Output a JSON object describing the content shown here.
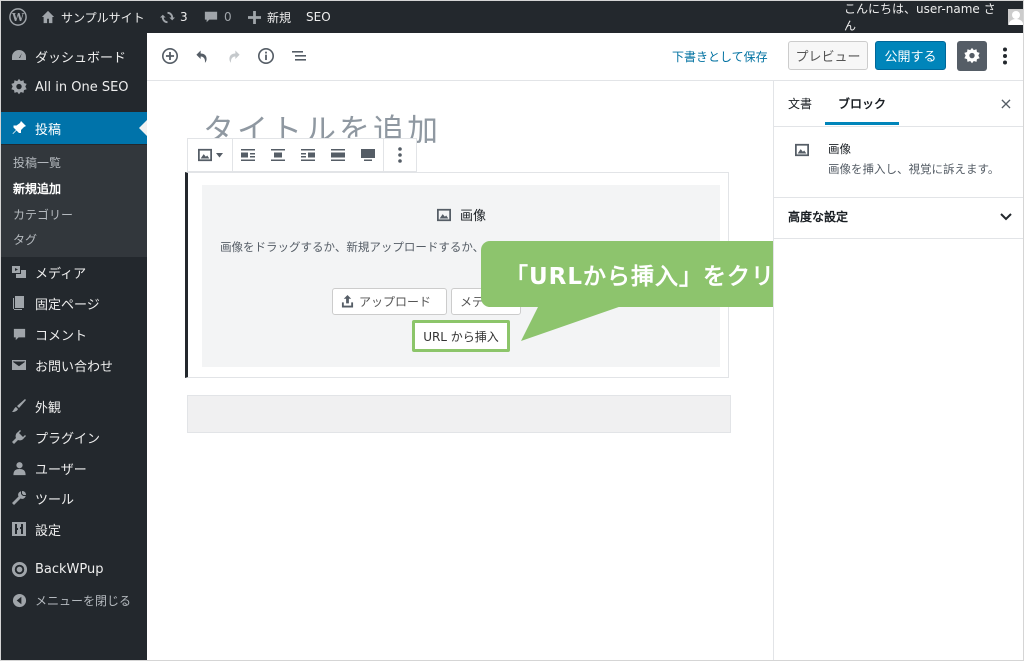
{
  "adminbar": {
    "site_name": "サンプルサイト",
    "updates_count": "3",
    "comments_count": "0",
    "new_label": "新規",
    "seo_label": "SEO",
    "greeting": "こんにちは、user-name さん"
  },
  "sidebar": {
    "items": [
      {
        "label": "ダッシュボード",
        "icon": "dashboard-icon"
      },
      {
        "label": "All in One SEO",
        "icon": "gear-icon"
      },
      {
        "label": "投稿",
        "icon": "pin-icon"
      },
      {
        "label": "メディア",
        "icon": "media-icon"
      },
      {
        "label": "固定ページ",
        "icon": "page-icon"
      },
      {
        "label": "コメント",
        "icon": "comment-icon"
      },
      {
        "label": "お問い合わせ",
        "icon": "mail-icon"
      },
      {
        "label": "外観",
        "icon": "brush-icon"
      },
      {
        "label": "プラグイン",
        "icon": "plugin-icon"
      },
      {
        "label": "ユーザー",
        "icon": "user-icon"
      },
      {
        "label": "ツール",
        "icon": "wrench-icon"
      },
      {
        "label": "設定",
        "icon": "settings-icon"
      },
      {
        "label": "BackWPup",
        "icon": "backwpup-icon"
      },
      {
        "label": "メニューを閉じる",
        "icon": "collapse-icon"
      }
    ],
    "submenu": [
      "投稿一覧",
      "新規追加",
      "カテゴリー",
      "タグ"
    ]
  },
  "editor_header": {
    "save_draft": "下書きとして保存",
    "preview": "プレビュー",
    "publish": "公開する"
  },
  "editor": {
    "title_placeholder": "タイトルを追加",
    "image_block": {
      "label": "画像",
      "instructions": "画像をドラッグするか、新規アップロードするか、ライブラリから画像を選択してください。",
      "upload_button": "アップロード",
      "media_button": "メディアライブラリ",
      "url_button": "URL から挿入"
    }
  },
  "callout": {
    "text": "「URLから挿入」をクリック",
    "color": "#8dc46d"
  },
  "settings_sidebar": {
    "tab_document": "文書",
    "tab_block": "ブロック",
    "close": "×",
    "block_title": "画像",
    "block_description": "画像を挿入し、視覚に訴えます。",
    "advanced": "高度な設定"
  },
  "colors": {
    "admin_dark": "#23282d",
    "accent_blue": "#0073aa",
    "publish_blue": "#0085ba",
    "highlight_green": "#8cc56a"
  }
}
